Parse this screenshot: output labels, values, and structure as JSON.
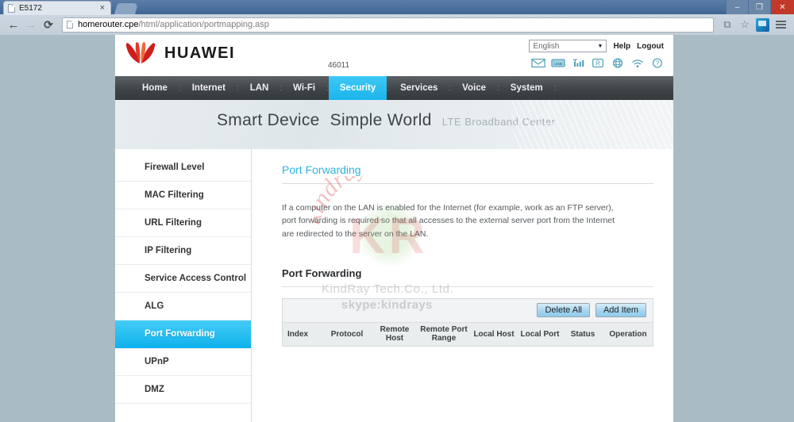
{
  "browser": {
    "tab_title": "E5172",
    "tab_close_label": "×",
    "back_icon": "←",
    "forward_icon": "→",
    "reload_icon": "⟳",
    "url_main": "homerouter.cpe",
    "url_path": "/html/application/portmapping.asp",
    "window_minimize": "–",
    "window_maximize": "❐",
    "window_close": "✕",
    "translate_icon": "⧉",
    "bookmark_icon": "☆"
  },
  "header": {
    "brand": "HUAWEI",
    "device_id": "46011",
    "language_selected": "English",
    "language_caret": "▼",
    "help_label": "Help",
    "logout_label": "Logout",
    "status_icons": [
      "mail-icon",
      "usb-icon",
      "signal-icon",
      "roaming-icon",
      "globe-icon",
      "wifi-icon",
      "help-question-icon"
    ]
  },
  "nav": {
    "items": [
      {
        "label": "Home",
        "active": false
      },
      {
        "label": "Internet",
        "active": false
      },
      {
        "label": "LAN",
        "active": false
      },
      {
        "label": "Wi-Fi",
        "active": false
      },
      {
        "label": "Security",
        "active": true
      },
      {
        "label": "Services",
        "active": false
      },
      {
        "label": "Voice",
        "active": false
      },
      {
        "label": "System",
        "active": false
      }
    ],
    "separator": ":"
  },
  "banner": {
    "line1": "Smart Device",
    "line2": "Simple World",
    "subtitle": "LTE Broadband Center"
  },
  "sidebar": {
    "items": [
      {
        "label": "Firewall Level",
        "active": false
      },
      {
        "label": "MAC Filtering",
        "active": false
      },
      {
        "label": "URL Filtering",
        "active": false
      },
      {
        "label": "IP Filtering",
        "active": false
      },
      {
        "label": "Service Access Control",
        "active": false
      },
      {
        "label": "ALG",
        "active": false
      },
      {
        "label": "Port Forwarding",
        "active": true
      },
      {
        "label": "UPnP",
        "active": false
      },
      {
        "label": "DMZ",
        "active": false
      }
    ]
  },
  "content": {
    "page_title": "Port Forwarding",
    "description": "If a computer on the LAN is enabled for the Internet (for example, work as an FTP server), port forwarding is required so that all accesses to the external server port from the Internet are redirected to the server on the LAN.",
    "section_title": "Port Forwarding",
    "delete_all_label": "Delete All",
    "add_item_label": "Add Item",
    "table_columns": [
      "Index",
      "Protocol",
      "Remote Host",
      "Remote Port Range",
      "Local Host",
      "Local Port",
      "Status",
      "Operation"
    ],
    "table_rows": []
  },
  "watermarks": {
    "arc_text": "kindrays",
    "initials": "KR",
    "company": "KindRay Tech.Co., Ltd.",
    "skype": "skype:kindrays"
  },
  "colors": {
    "accent_cyan": "#19b4ec",
    "brand_red": "#cf1c1c",
    "nav_dark": "#3f4448",
    "page_backdrop": "#a9bcc3",
    "icon_teal": "#4c9cb5"
  }
}
